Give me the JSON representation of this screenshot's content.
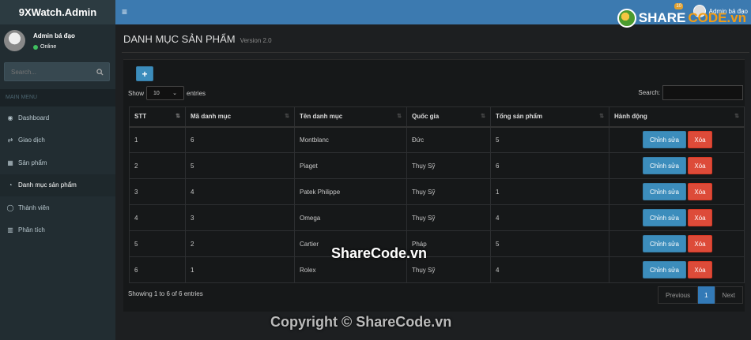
{
  "app": {
    "logo_bold": "9X",
    "logo_rest": "Watch.Admin"
  },
  "topbar": {
    "menu_icon": "hamburger-icon",
    "badge": "10",
    "user_name": "Admin bá đạo"
  },
  "sidebar": {
    "user_name": "Admin bá đạo",
    "status": "Online",
    "search_placeholder": "Search...",
    "menu_header": "MAIN MENU",
    "items": [
      {
        "label": "Dashboard",
        "icon": "dashboard-icon",
        "glyph": "◉"
      },
      {
        "label": "Giao dịch",
        "icon": "exchange-icon",
        "glyph": "⇄"
      },
      {
        "label": "Sản phẩm",
        "icon": "grid-icon",
        "glyph": "▦"
      },
      {
        "label": "Danh mục sản phẩm",
        "icon": "pie-chart-icon",
        "glyph": "◔",
        "active": true
      },
      {
        "label": "Thành viên",
        "icon": "user-icon",
        "glyph": "◯"
      },
      {
        "label": "Phân tích",
        "icon": "bar-chart-icon",
        "glyph": "▥"
      }
    ]
  },
  "page": {
    "title": "DANH MỤC SẢN PHẨM",
    "subtitle": "Version 2.0"
  },
  "table_controls": {
    "show_label": "Show",
    "length_value": "10",
    "entries_label": "entries",
    "search_label": "Search:",
    "add_label": "+"
  },
  "table": {
    "columns": [
      "STT",
      "Mã danh mục",
      "Tên danh mục",
      "Quốc gia",
      "Tổng sản phẩm",
      "Hành động"
    ],
    "rows": [
      [
        "1",
        "6",
        "Montblanc",
        "Đức",
        "5"
      ],
      [
        "2",
        "5",
        "Piaget",
        "Thụy Sỹ",
        "6"
      ],
      [
        "3",
        "4",
        "Patek Philippe",
        "Thụy Sỹ",
        "1"
      ],
      [
        "4",
        "3",
        "Omega",
        "Thụy Sỹ",
        "4"
      ],
      [
        "5",
        "2",
        "Cartier",
        "Pháp",
        "5"
      ],
      [
        "6",
        "1",
        "Rolex",
        "Thụy Sỹ",
        "4"
      ]
    ],
    "edit_label": "Chỉnh sửa",
    "delete_label": "Xóa"
  },
  "footer": {
    "info": "Showing 1 to 6 of 6 entries",
    "prev": "Previous",
    "page": "1",
    "next": "Next"
  },
  "watermarks": {
    "logo_part1": "SHARE",
    "logo_part2": "CODE.vn",
    "center": "ShareCode.vn",
    "bottom": "Copyright © ShareCode.vn"
  },
  "colors": {
    "topbar": "#3c7ab0",
    "sidebar": "#222d32",
    "primary": "#3c8dbc",
    "danger": "#dd4b39"
  }
}
